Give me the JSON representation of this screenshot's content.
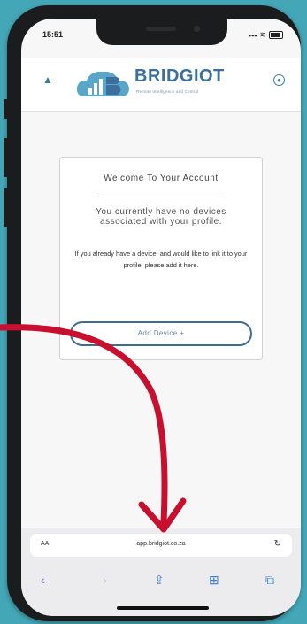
{
  "status_bar": {
    "time": "15:51"
  },
  "app": {
    "logo_word": "BRIDGIOT",
    "logo_tagline": "Remote Intelligence and Control",
    "home_icon": "home-icon",
    "account_icon": "account-icon"
  },
  "card": {
    "title": "Welcome To Your Account",
    "message": "You currently have no devices associated with your profile.",
    "hint": "If you already have a device, and would like to link it to your profile, please add it here.",
    "add_button": "Add Device +"
  },
  "browser": {
    "text_size": "AA",
    "url": "app.bridgiot.co.za",
    "icons": [
      "back-icon",
      "forward-icon",
      "share-icon",
      "bookmarks-icon",
      "tabs-icon"
    ]
  },
  "colors": {
    "background": "#44a7b8",
    "brand": "#3c6f9d",
    "arrow": "#c8102e",
    "safari_blue": "#3b7cd4"
  }
}
